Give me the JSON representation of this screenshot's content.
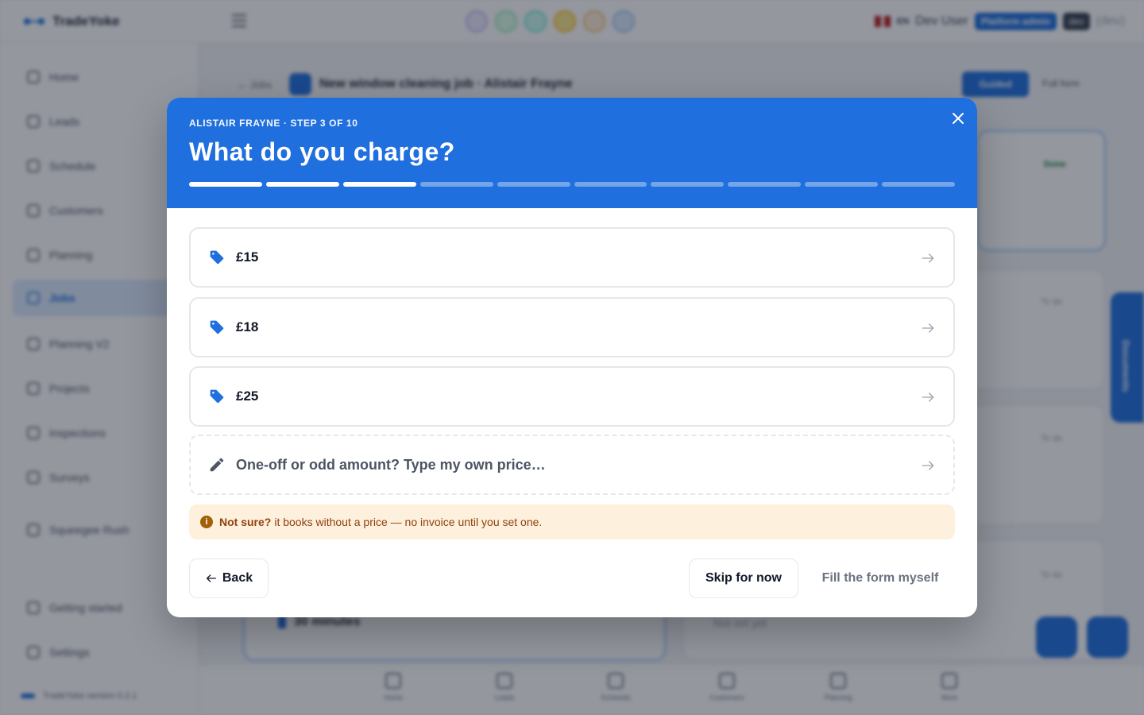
{
  "app": {
    "brand": "TradeYoke",
    "user": "Dev User",
    "lang": "EN",
    "role_badge": "Platform admin",
    "env_badge": "dev",
    "env_label": "(dev)",
    "version": "TradeYoke version 0.2.1"
  },
  "sidebar": {
    "items": [
      {
        "label": "Home"
      },
      {
        "label": "Leads"
      },
      {
        "label": "Schedule"
      },
      {
        "label": "Customers"
      },
      {
        "label": "Planning"
      },
      {
        "label": "Jobs"
      },
      {
        "label": "Planning V2"
      },
      {
        "label": "Projects"
      },
      {
        "label": "Inspections"
      },
      {
        "label": "Surveys"
      },
      {
        "label": "Squeegee Rush"
      },
      {
        "label": "Getting started"
      },
      {
        "label": "Settings"
      }
    ]
  },
  "page": {
    "back_label": "← Jobs",
    "title": "New window cleaning job · Alistair Frayne",
    "guided_label": "Guided",
    "full_form_label": "Full form",
    "status_done": "Done",
    "status_todo": "To do",
    "duration": "30 minutes",
    "not_set": "Not set yet",
    "side_tab": "Documents"
  },
  "bottom_nav": {
    "items": [
      {
        "label": "Home"
      },
      {
        "label": "Leads"
      },
      {
        "label": "Schedule"
      },
      {
        "label": "Customers"
      },
      {
        "label": "Planning"
      },
      {
        "label": "More"
      }
    ]
  },
  "modal": {
    "eyebrow": "ALISTAIR FRAYNE · STEP 3 OF 10",
    "title": "What do you charge?",
    "steps_total": 10,
    "steps_completed": 3,
    "options": [
      {
        "label": "£15"
      },
      {
        "label": "£18"
      },
      {
        "label": "£25"
      }
    ],
    "custom_option": "One-off or odd amount? Type my own price…",
    "notice_bold": "Not sure?",
    "notice_text": "it books without a price — no invoice until you set one.",
    "back_button": "Back",
    "skip_button": "Skip for now",
    "fill_button": "Fill the form myself"
  },
  "colors": {
    "brand": "#1f6fde",
    "notice_bg": "#fdf0dd",
    "notice_text": "#92400e"
  }
}
